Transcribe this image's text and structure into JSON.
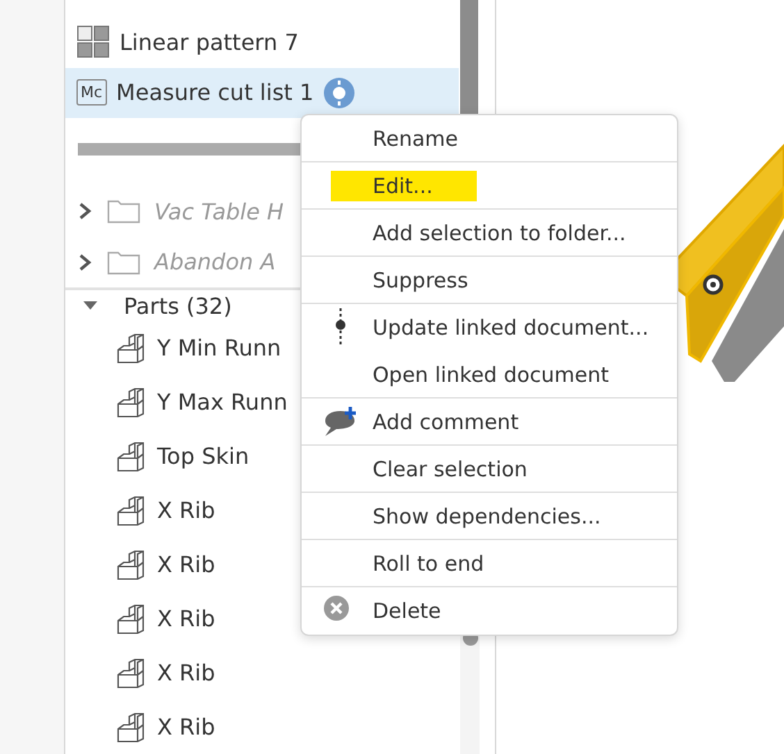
{
  "features": [
    {
      "label": "Linear pattern 7",
      "kind": "pattern",
      "selected": false
    },
    {
      "label": "Measure cut list 1",
      "kind": "measure",
      "icon_text": "Mc",
      "selected": true,
      "info": true
    }
  ],
  "folders": [
    {
      "label": "Vac Table H",
      "expanded": false
    },
    {
      "label": "Abandon A",
      "expanded": false
    }
  ],
  "parts_header": {
    "label": "Parts (32)",
    "expanded": true
  },
  "parts": [
    "Y Min Runn",
    "Y Max Runn",
    "Top Skin",
    "X Rib",
    "X Rib",
    "X Rib",
    "X Rib",
    "X Rib"
  ],
  "context_menu": [
    {
      "label": "Rename",
      "divider_after": true,
      "highlighted": false
    },
    {
      "label": "Edit...",
      "divider_after": true,
      "highlighted": true
    },
    {
      "label": "Add selection to folder...",
      "divider_after": true,
      "highlighted": false
    },
    {
      "label": "Suppress",
      "divider_after": true,
      "highlighted": false
    },
    {
      "label": "Update linked document...",
      "divider_after": false,
      "highlighted": false,
      "kind": "linked"
    },
    {
      "label": "Open linked document",
      "divider_after": true,
      "highlighted": false
    },
    {
      "label": "Add comment",
      "divider_after": true,
      "highlighted": false,
      "kind": "comment"
    },
    {
      "label": "Clear selection",
      "divider_after": true,
      "highlighted": false
    },
    {
      "label": "Show dependencies...",
      "divider_after": true,
      "highlighted": false
    },
    {
      "label": "Roll to end",
      "divider_after": true,
      "highlighted": false
    },
    {
      "label": "Delete",
      "divider_after": false,
      "highlighted": false,
      "kind": "delete"
    }
  ]
}
